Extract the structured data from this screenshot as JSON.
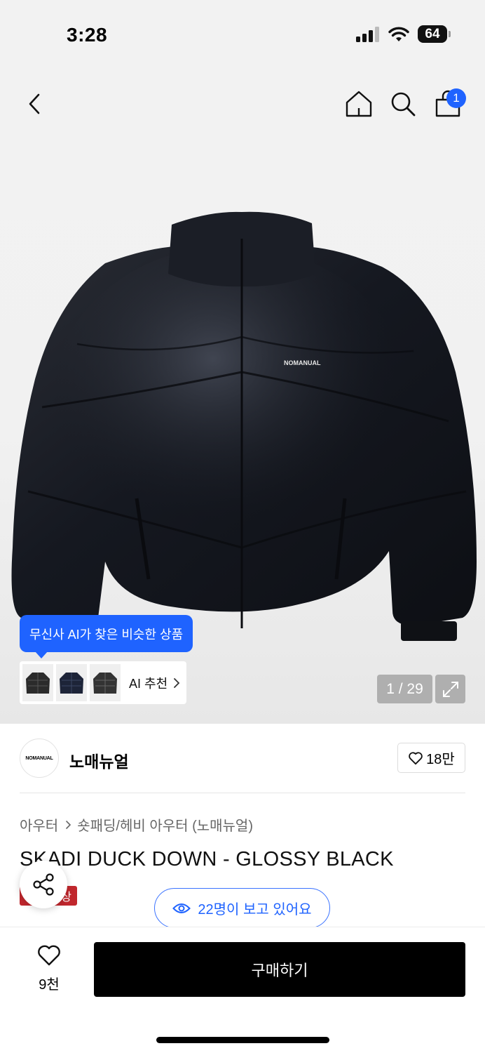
{
  "status": {
    "time": "3:28",
    "battery": "64",
    "icons": [
      "signal-icon",
      "wifi-icon",
      "battery-icon"
    ]
  },
  "nav": {
    "icons": [
      "back-icon",
      "home-icon",
      "search-icon",
      "bag-icon"
    ],
    "cart_count": "1"
  },
  "gallery": {
    "photo_logo_text": "NOMANUAL",
    "ai_tooltip": "무신사 AI가 찾은 비슷한 상품",
    "ai_recommend_label": "AI 추천",
    "page_counter": "1 / 29"
  },
  "brand": {
    "logo_text": "NOMANUAL",
    "name": "노매뉴얼",
    "likes": "18만"
  },
  "breadcrumb": {
    "level1": "아우터",
    "level2": "숏패딩/헤비 아우터 (노매뉴얼)"
  },
  "product": {
    "title": "SKADI DUCK DOWN - GLOSSY BLACK",
    "badge": "상"
  },
  "viewers": {
    "text": "22명이 보고 있어요"
  },
  "purchase": {
    "wish_count": "9천",
    "buy_label": "구매하기"
  },
  "colors": {
    "accent": "#1f63ff",
    "badge": "#c1272d",
    "buy_button": "#000000"
  }
}
